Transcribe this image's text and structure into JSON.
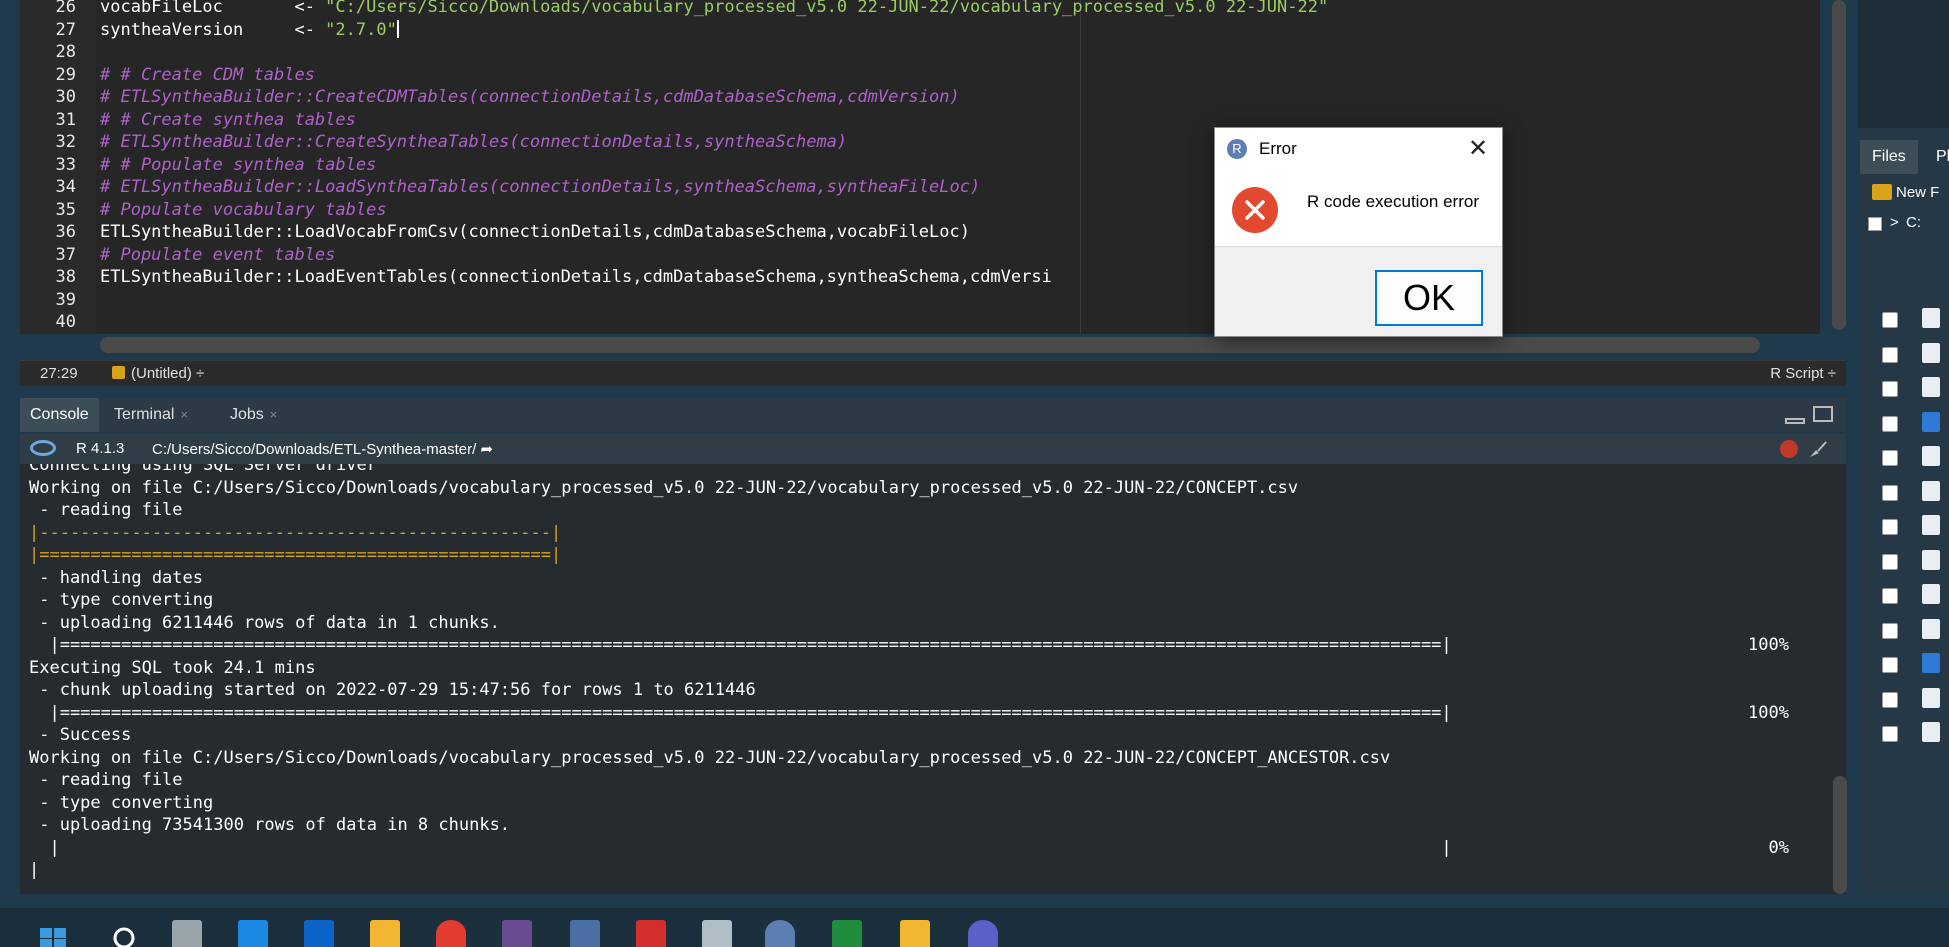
{
  "editor": {
    "lines": [
      {
        "num": "26",
        "kind": "plain",
        "pre": "vocabFileLoc       <- ",
        "str": "\"C:/Users/Sicco/Downloads/vocabulary_processed_v5.0 22-JUN-22/vocabulary_processed_v5.0 22-JUN-22\""
      },
      {
        "num": "27",
        "kind": "plain",
        "pre": "syntheaVersion     <- ",
        "str": "\"2.7.0\""
      },
      {
        "num": "28",
        "kind": "plain",
        "pre": "",
        "str": ""
      },
      {
        "num": "29",
        "kind": "comment",
        "pre": "# # Create CDM tables",
        "str": ""
      },
      {
        "num": "30",
        "kind": "comment",
        "pre": "# ETLSyntheaBuilder::CreateCDMTables(connectionDetails,cdmDatabaseSchema,cdmVersion)",
        "str": ""
      },
      {
        "num": "31",
        "kind": "comment",
        "pre": "# # Create synthea tables",
        "str": ""
      },
      {
        "num": "32",
        "kind": "comment",
        "pre": "# ETLSyntheaBuilder::CreateSyntheaTables(connectionDetails,syntheaSchema)",
        "str": ""
      },
      {
        "num": "33",
        "kind": "comment",
        "pre": "# # Populate synthea tables",
        "str": ""
      },
      {
        "num": "34",
        "kind": "comment",
        "pre": "# ETLSyntheaBuilder::LoadSyntheaTables(connectionDetails,syntheaSchema,syntheaFileLoc)",
        "str": ""
      },
      {
        "num": "35",
        "kind": "comment",
        "pre": "# Populate vocabulary tables",
        "str": ""
      },
      {
        "num": "36",
        "kind": "plain",
        "pre": "ETLSyntheaBuilder::LoadVocabFromCsv(connectionDetails,cdmDatabaseSchema,vocabFileLoc)",
        "str": ""
      },
      {
        "num": "37",
        "kind": "comment",
        "pre": "# Populate event tables",
        "str": ""
      },
      {
        "num": "38",
        "kind": "plain",
        "pre": "ETLSyntheaBuilder::LoadEventTables(connectionDetails,cdmDatabaseSchema,syntheaSchema,cdmVersi",
        "str": ""
      },
      {
        "num": "39",
        "kind": "plain",
        "pre": "",
        "str": ""
      },
      {
        "num": "40",
        "kind": "plain",
        "pre": "",
        "str": ""
      }
    ],
    "status": {
      "position": "27:29",
      "scope": "(Untitled)",
      "scope_arrow": "÷",
      "file_type": "R Script ÷"
    }
  },
  "console_tabs": [
    {
      "label": "Console",
      "close": ""
    },
    {
      "label": "Terminal",
      "close": "×"
    },
    {
      "label": "Jobs",
      "close": "×"
    }
  ],
  "console_head": {
    "version": "R 4.1.3",
    "path": "C:/Users/Sicco/Downloads/ETL-Synthea-master/",
    "path_arrow": "➦"
  },
  "console_lines": [
    {
      "text": "Connecting using SQL Server driver",
      "kind": "out",
      "pct": ""
    },
    {
      "text": "Working on file C:/Users/Sicco/Downloads/vocabulary_processed_v5.0 22-JUN-22/vocabulary_processed_v5.0 22-JUN-22/CONCEPT.csv",
      "kind": "out",
      "pct": ""
    },
    {
      "text": " - reading file",
      "kind": "out",
      "pct": ""
    },
    {
      "text": "|--------------------------------------------------|",
      "kind": "bar",
      "pct": ""
    },
    {
      "text": "|==================================================|",
      "kind": "bar",
      "pct": ""
    },
    {
      "text": " - handling dates",
      "kind": "out",
      "pct": ""
    },
    {
      "text": " - type converting",
      "kind": "out",
      "pct": ""
    },
    {
      "text": " - uploading 6211446 rows of data in 1 chunks.",
      "kind": "out",
      "pct": ""
    },
    {
      "text": "  |=======================================================================================================================================|",
      "kind": "out",
      "pct": "100%"
    },
    {
      "text": "Executing SQL took 24.1 mins",
      "kind": "out",
      "pct": ""
    },
    {
      "text": " - chunk uploading started on 2022-07-29 15:47:56 for rows 1 to 6211446",
      "kind": "out",
      "pct": ""
    },
    {
      "text": "  |=======================================================================================================================================|",
      "kind": "out",
      "pct": "100%"
    },
    {
      "text": " - Success",
      "kind": "out",
      "pct": ""
    },
    {
      "text": "Working on file C:/Users/Sicco/Downloads/vocabulary_processed_v5.0 22-JUN-22/vocabulary_processed_v5.0 22-JUN-22/CONCEPT_ANCESTOR.csv",
      "kind": "out",
      "pct": ""
    },
    {
      "text": " - reading file",
      "kind": "out",
      "pct": ""
    },
    {
      "text": " - type converting",
      "kind": "out",
      "pct": ""
    },
    {
      "text": " - uploading 73541300 rows of data in 8 chunks.",
      "kind": "out",
      "pct": ""
    },
    {
      "text": "  |                                                                                                                                       |",
      "kind": "out",
      "pct": "0%"
    },
    {
      "text": "|",
      "kind": "out",
      "pct": ""
    }
  ],
  "right_pane": {
    "tabs": [
      "Files",
      "Pl"
    ],
    "new_folder": "New F",
    "path": "C:"
  },
  "dialog": {
    "title": "Error",
    "r_icon": "R",
    "close": "✕",
    "error_icon": "×",
    "message": "R code execution error",
    "ok": "OK"
  },
  "colors": {
    "accent": "#0078d7",
    "error": "#e2492f",
    "comment": "#b061c9",
    "string": "#9ccc65"
  }
}
